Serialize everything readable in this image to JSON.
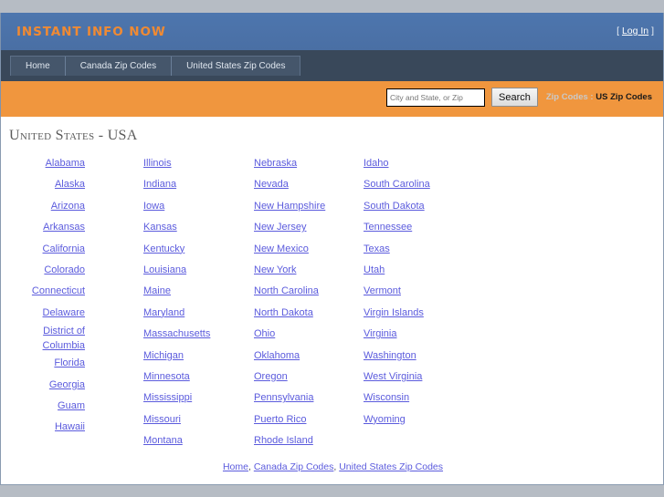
{
  "site": {
    "logo_text": "INSTANT INFO NOW",
    "login_open_bracket": "[",
    "login_label": "Log In",
    "login_close_bracket": "]"
  },
  "nav": {
    "tabs": [
      {
        "label": "Home"
      },
      {
        "label": "Canada Zip Codes"
      },
      {
        "label": "United States Zip Codes"
      }
    ]
  },
  "search": {
    "placeholder": "City and State, or Zip",
    "value": "",
    "button_label": "Search",
    "breadcrumb_parent": "Zip Codes",
    "breadcrumb_separator": ":",
    "breadcrumb_current": "US Zip Codes"
  },
  "main": {
    "page_title": "United States - USA",
    "columns": [
      {
        "items": [
          "Alabama",
          "Alaska",
          "Arizona",
          "Arkansas",
          "California",
          "Colorado",
          "Connecticut",
          "Delaware",
          "District of Columbia",
          "Florida",
          "Georgia",
          "Guam",
          "Hawaii"
        ]
      },
      {
        "items": [
          "Illinois",
          "Indiana",
          "Iowa",
          "Kansas",
          "Kentucky",
          "Louisiana",
          "Maine",
          "Maryland",
          "Massachusetts",
          "Michigan",
          "Minnesota",
          "Mississippi",
          "Missouri",
          "Montana"
        ]
      },
      {
        "items": [
          "Nebraska",
          "Nevada",
          "New Hampshire",
          "New Jersey",
          "New Mexico",
          "New York",
          "North Carolina",
          "North Dakota",
          "Ohio",
          "Oklahoma",
          "Oregon",
          "Pennsylvania",
          "Puerto Rico",
          "Rhode Island"
        ]
      },
      {
        "items": [
          "Idaho",
          "South Carolina",
          "South Dakota",
          "Tennessee",
          "Texas",
          "Utah",
          "Vermont",
          "Virgin Islands",
          "Virginia",
          "Washington",
          "West Virginia",
          "Wisconsin",
          "Wyoming"
        ]
      }
    ]
  },
  "footer": {
    "links": [
      {
        "label": "Home"
      },
      {
        "label": "Canada Zip Codes"
      },
      {
        "label": "United States Zip Codes"
      }
    ],
    "separator": ","
  },
  "colors": {
    "header_blue": "#4c74ab",
    "nav_dark": "#39485a",
    "accent_orange": "#f0963e",
    "logo_orange": "#f08a33",
    "link_blue": "#5b5bdd",
    "page_bg_gray": "#b6bcc4"
  }
}
